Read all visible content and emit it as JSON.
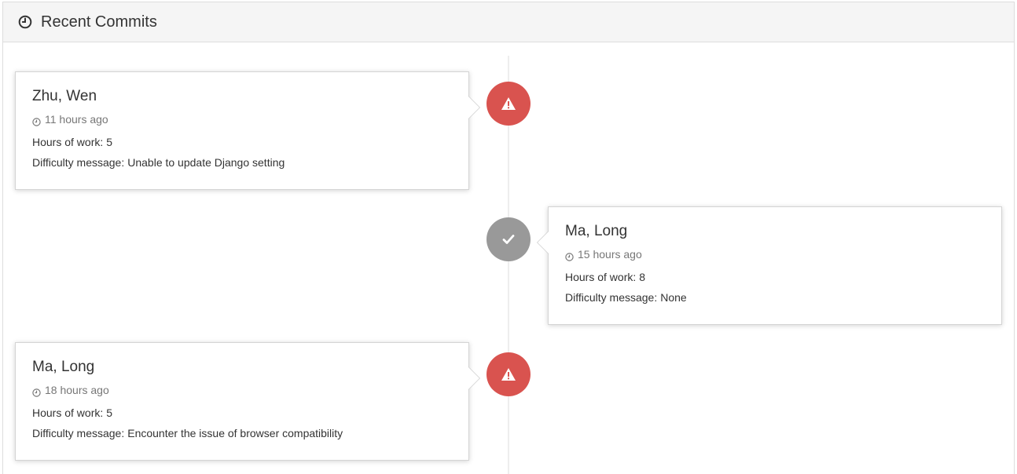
{
  "panel": {
    "title": "Recent Commits",
    "icon": "clock-icon"
  },
  "labels": {
    "hours": "Hours of work:",
    "difficulty": "Difficulty message:"
  },
  "colors": {
    "warning_badge": "#d9534f",
    "success_badge": "#999999",
    "timeline": "#eeeeee",
    "header_bg": "#f5f5f5"
  },
  "commits": [
    {
      "name": "Zhu, Wen",
      "time": "11 hours ago",
      "hours": "5",
      "difficulty": "Unable to update Django setting",
      "status_icon": "warning-icon",
      "side": "left"
    },
    {
      "name": "Ma, Long",
      "time": "15 hours ago",
      "hours": "8",
      "difficulty": "None",
      "status_icon": "check-icon",
      "side": "right"
    },
    {
      "name": "Ma, Long",
      "time": "18 hours ago",
      "hours": "5",
      "difficulty": "Encounter the issue of browser compatibility",
      "status_icon": "warning-icon",
      "side": "left"
    }
  ]
}
